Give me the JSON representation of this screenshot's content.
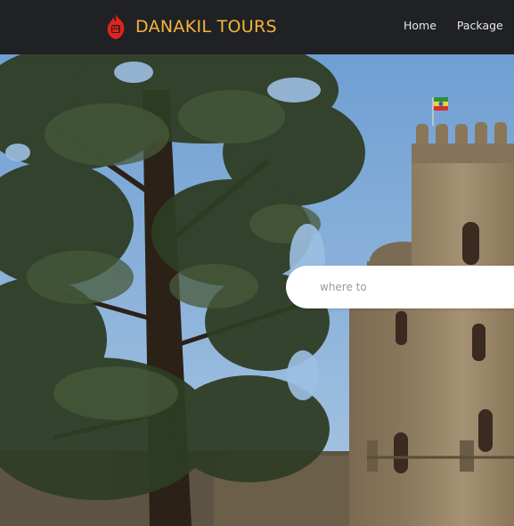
{
  "brand": {
    "name": "DANAKIL TOURS",
    "logo_icon": "fist-flame-logo-icon",
    "name_color": "#f4b53a",
    "logo_color": "#e0241b"
  },
  "nav": {
    "items": [
      {
        "label": "Home"
      },
      {
        "label": "Package"
      }
    ]
  },
  "search": {
    "placeholder": "where to",
    "value": ""
  },
  "colors": {
    "navbar_bg": "#1f2125",
    "nav_text": "#e8e8e8"
  }
}
